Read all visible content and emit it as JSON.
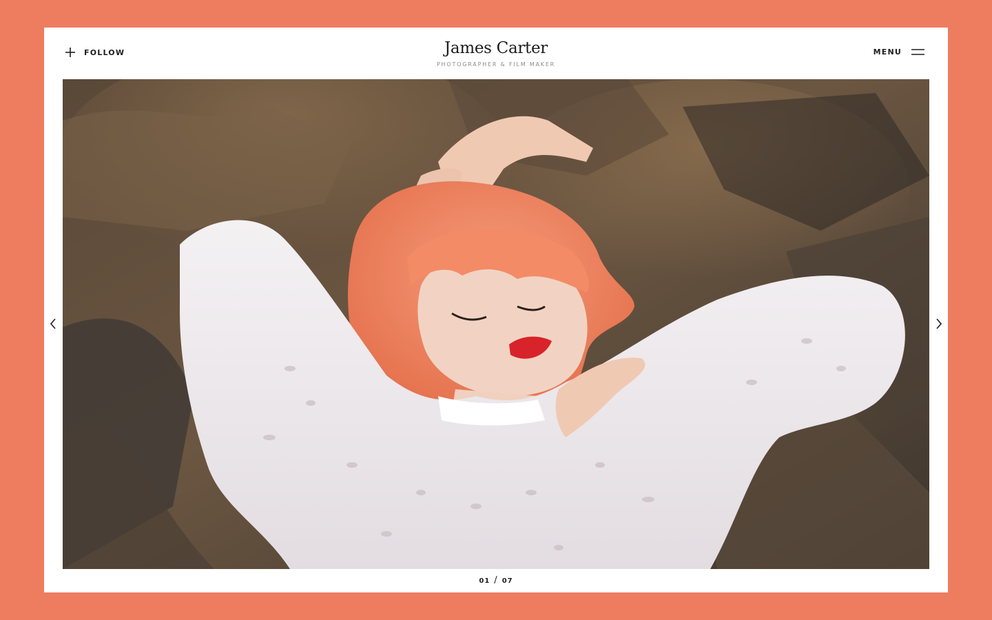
{
  "header": {
    "follow_label": "FOLLOW",
    "title": "James Carter",
    "subtitle": "PHOTOGRAPHER & FILM MAKER",
    "menu_label": "MENU"
  },
  "slider": {
    "current": "01",
    "separator": "/",
    "total": "07"
  },
  "icons": {
    "follow": "plus-icon",
    "menu": "hamburger-icon",
    "prev": "chevron-left-icon",
    "next": "chevron-right-icon"
  },
  "colors": {
    "background": "#ee7c5f",
    "frame": "#ffffff",
    "text": "#1d1d1d",
    "subtitle": "#8a8a8a"
  }
}
